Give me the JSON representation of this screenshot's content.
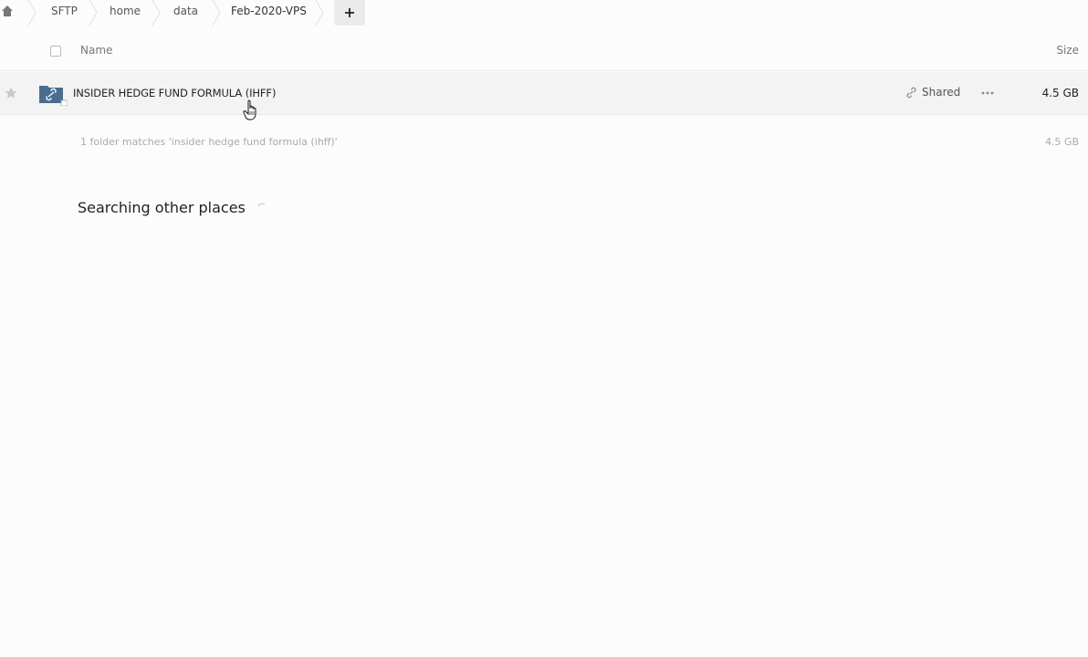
{
  "breadcrumb": {
    "items": [
      "SFTP",
      "home",
      "data",
      "Feb-2020-VPS"
    ]
  },
  "header": {
    "name_label": "Name",
    "size_label": "Size"
  },
  "file": {
    "name": "INSIDER HEDGE FUND FORMULA (IHFF)",
    "shared_label": "Shared",
    "size": "4.5 GB"
  },
  "summary": {
    "text": "1 folder matches 'insider hedge fund formula (ihff)'",
    "size": "4.5 GB"
  },
  "search": {
    "label": "Searching other places"
  },
  "colors": {
    "folder": "#4a6d8f",
    "background": "#fcfcfc",
    "row_hover": "#f3f3f3"
  }
}
